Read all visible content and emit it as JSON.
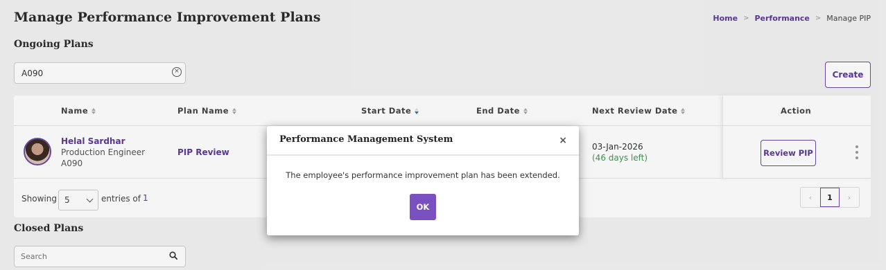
{
  "page": {
    "title": "Manage Performance Improvement Plans",
    "breadcrumb": {
      "home": "Home",
      "sep1": ">",
      "performance": "Performance",
      "sep2": ">",
      "current": "Manage PIP"
    }
  },
  "ongoing": {
    "section_title": "Ongoing Plans",
    "filter_value": "A090",
    "clear_symbol": "×",
    "create_label": "Create",
    "columns": {
      "name": "Name",
      "plan_name": "Plan Name",
      "start_date": "Start Date",
      "end_date": "End Date",
      "next_review_date": "Next Review Date",
      "action": "Action"
    },
    "rows": [
      {
        "name": "Helal Sardhar",
        "role": "Production Engineer",
        "id": "A090",
        "plan_name": "PIP Review",
        "next_review_date": "03-Jan-2026",
        "days_left": "(46 days left)",
        "action_label": "Review PIP"
      }
    ],
    "footer": {
      "showing": "Showing",
      "page_size": "5",
      "entries_of": "entries of",
      "total": "1",
      "prev": "‹",
      "current_page": "1",
      "next": "›"
    }
  },
  "closed": {
    "section_title": "Closed Plans",
    "search_placeholder": "Search"
  },
  "modal": {
    "title": "Performance Management System",
    "close_symbol": "×",
    "message": "The employee's performance improvement plan has been extended.",
    "ok_label": "OK"
  },
  "colors": {
    "accent": "#5b3a9a",
    "button_primary": "#7a4fbf",
    "success_text": "#3e9b4f",
    "sort_active": "#2a6ec7"
  }
}
